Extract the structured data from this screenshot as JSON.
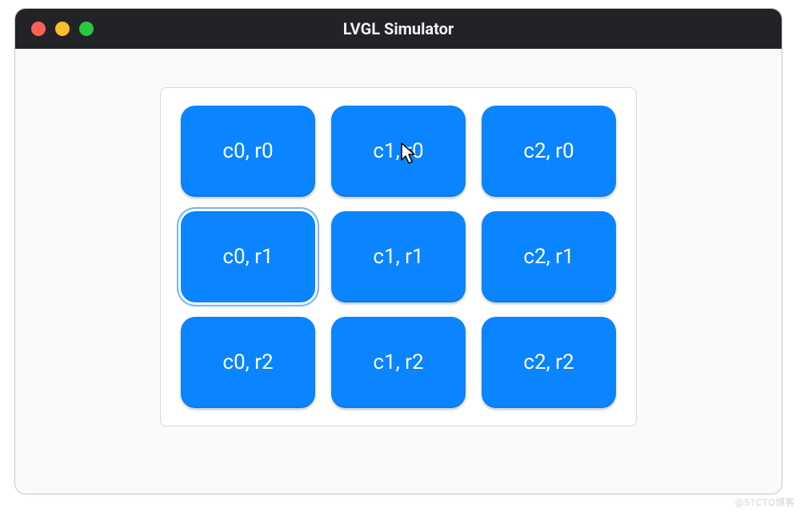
{
  "window": {
    "title": "LVGL Simulator"
  },
  "grid": {
    "columns": 3,
    "rows": 3,
    "focused_index": 3,
    "cursor_over_index": 1,
    "buttons": [
      {
        "label": "c0, r0"
      },
      {
        "label": "c1, r0"
      },
      {
        "label": "c2, r0"
      },
      {
        "label": "c0, r1"
      },
      {
        "label": "c1, r1"
      },
      {
        "label": "c2, r1"
      },
      {
        "label": "c0, r2"
      },
      {
        "label": "c1, r2"
      },
      {
        "label": "c2, r2"
      }
    ]
  },
  "watermark": "@51CTO博客"
}
